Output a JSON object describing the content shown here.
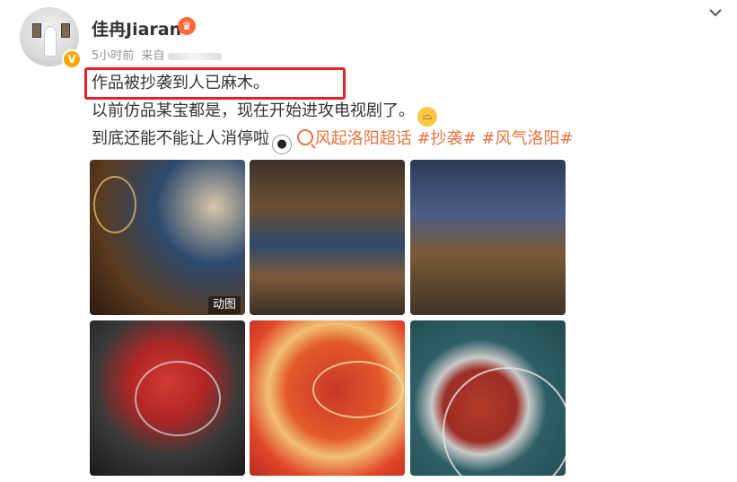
{
  "header": {
    "username": "佳冉Jiaran",
    "time": "5小时前",
    "source_prefix": "来自",
    "member_badge": "♛",
    "verified_badge": "V"
  },
  "post": {
    "line1": "作品被抄袭到人已麻木。",
    "line2": "以前仿品某宝都是，现在开始进攻电视剧了。",
    "line3_prefix": "到底还能不能让人消停啦",
    "topics": [
      "风起洛阳超话",
      "#抄袭#",
      "#风气洛阳#"
    ]
  },
  "media": {
    "gif_badge": "动图",
    "images": [
      {
        "name": "drama-still-1"
      },
      {
        "name": "drama-still-2"
      },
      {
        "name": "drama-still-3"
      },
      {
        "name": "fan-photo-1"
      },
      {
        "name": "fan-photo-2"
      },
      {
        "name": "fan-photo-3"
      }
    ]
  },
  "colors": {
    "topic": "#eb7340",
    "highlight": "#e52026",
    "verified": "#f7a800"
  }
}
